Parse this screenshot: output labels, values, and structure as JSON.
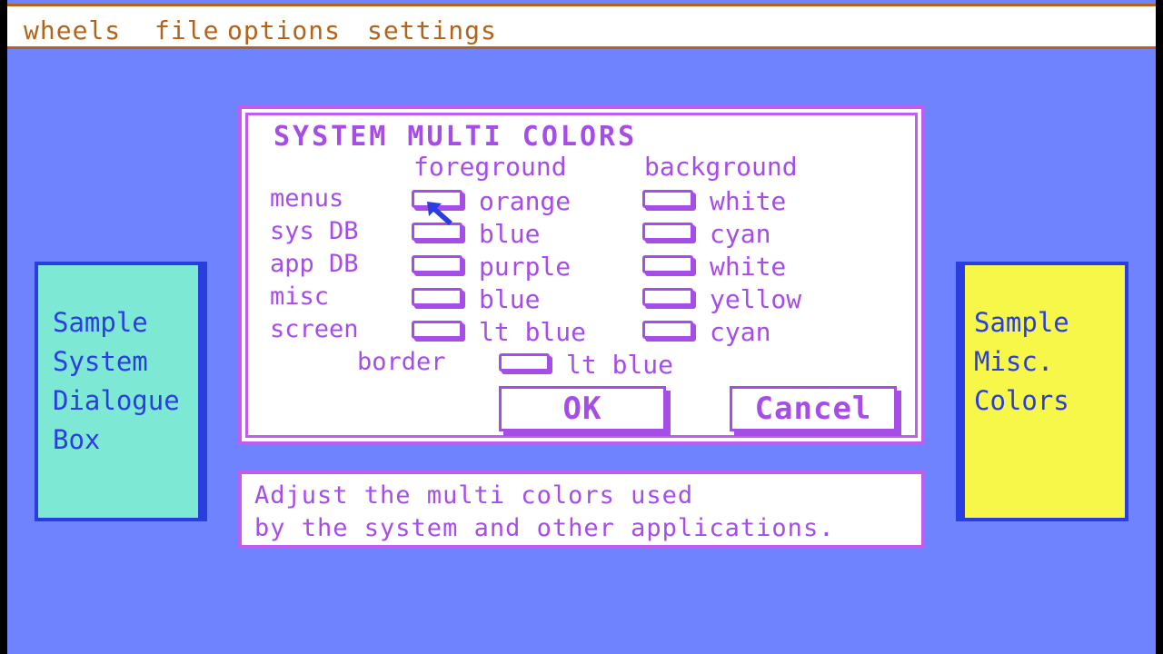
{
  "menubar": {
    "items": [
      "wheels",
      "file",
      "options",
      "settings"
    ]
  },
  "dialog": {
    "title": "SYSTEM MULTI COLORS",
    "foreground_header": "foreground",
    "background_header": "background",
    "rows": [
      {
        "label": "menus",
        "foreground": "orange",
        "background": "white"
      },
      {
        "label": "sys DB",
        "foreground": "blue",
        "background": "cyan"
      },
      {
        "label": "app DB",
        "foreground": "purple",
        "background": "white"
      },
      {
        "label": "misc",
        "foreground": "blue",
        "background": "yellow"
      },
      {
        "label": "screen",
        "foreground": "lt blue",
        "background": "cyan"
      }
    ],
    "border_label": "border",
    "border_color": "lt blue",
    "ok_label": "OK",
    "cancel_label": "Cancel"
  },
  "help": {
    "line1": "Adjust the multi colors used",
    "line2": "by the system and other applications."
  },
  "sample_left": {
    "lines": [
      "Sample",
      "System",
      "Dialogue",
      "Box"
    ]
  },
  "sample_right": {
    "lines": [
      "Sample",
      "Misc.",
      "Colors"
    ]
  },
  "colors": {
    "screen_bg": "#7083ff",
    "menu_text": "#b2651a",
    "dialog_accent": "#a64de8",
    "sample_left_bg": "#7de8d4",
    "sample_right_bg": "#f7f74a",
    "sample_text": "#2a3ee0"
  }
}
